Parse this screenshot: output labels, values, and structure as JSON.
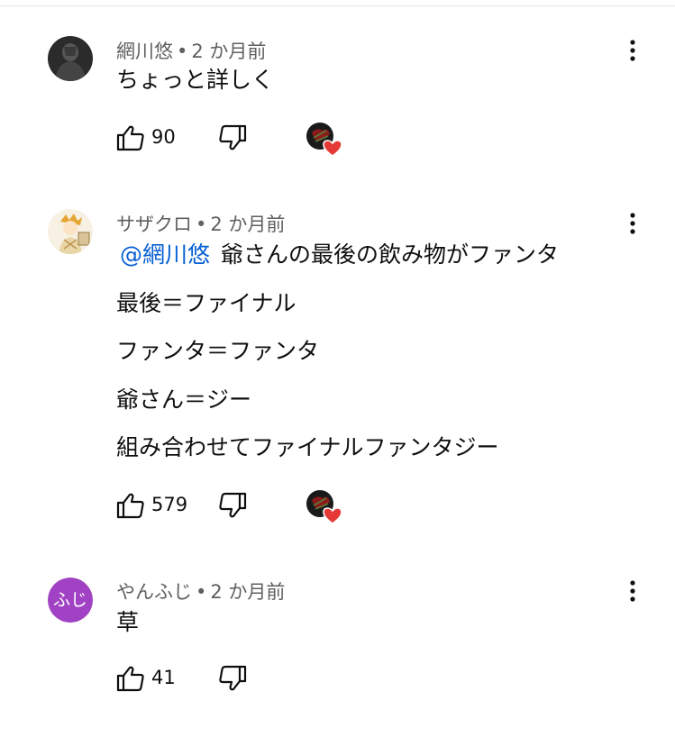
{
  "comments": [
    {
      "author": "網川悠",
      "time": "2 か月前",
      "separator": "•",
      "lines": [
        "ちょっと詳しく"
      ],
      "likes": "90",
      "icons": {
        "like": "thumbs-up-icon",
        "dislike": "thumbs-down-icon",
        "more": "more-vert-icon",
        "heart": "creator-heart-icon"
      }
    },
    {
      "author": "サザクロ",
      "time": "2 か月前",
      "separator": "•",
      "mention": "@網川悠",
      "first_line": "爺さんの最後の飲み物がファンタ",
      "lines": [
        "最後＝ファイナル",
        "ファンタ＝ファンタ",
        "爺さん＝ジー",
        "組み合わせてファイナルファンタジー"
      ],
      "likes": "579"
    },
    {
      "author": "やんふじ",
      "avatar_text": "ふじ",
      "time": "2 か月前",
      "separator": "•",
      "lines": [
        "草"
      ],
      "likes": "41"
    }
  ],
  "colors": {
    "mention": "#065fd4",
    "meta": "#606060",
    "heart": "#e53935",
    "avatar_purple": "#a142c4"
  }
}
